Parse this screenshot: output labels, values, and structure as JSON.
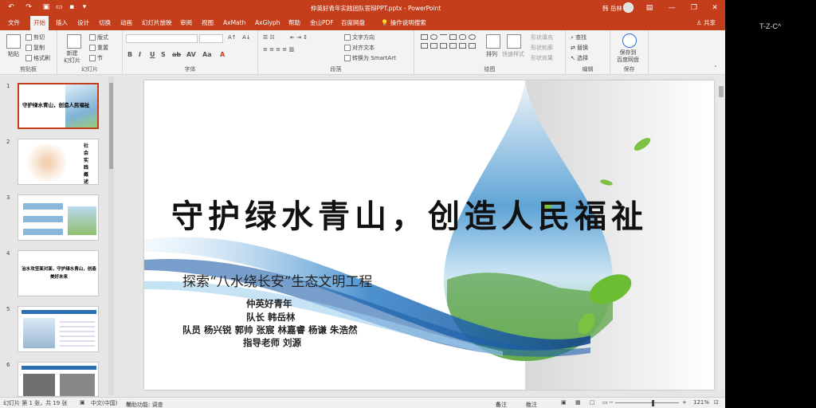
{
  "window": {
    "title": "仲英好青年实践团队答辩PPT.pptx  -  PowerPoint",
    "user": "韩 岳林"
  },
  "tabs": [
    "文件",
    "开始",
    "插入",
    "设计",
    "切换",
    "动画",
    "幻灯片放映",
    "审阅",
    "视图",
    "AxMath",
    "AxGlyph",
    "帮助",
    "金山PDF",
    "百度网盘",
    "操作说明搜索"
  ],
  "active_tab": "开始",
  "share_label": "共享",
  "ribbon": {
    "groups": {
      "clipboard": "剪贴板",
      "slides": "幻灯片",
      "font": "字体",
      "paragraph": "段落",
      "drawing": "绘图",
      "editing": "编辑",
      "save": "保存"
    },
    "clipboard": {
      "paste": "粘贴",
      "cut": "剪切",
      "copy": "复制",
      "format_painter": "格式刷"
    },
    "slides": {
      "new_slide": "新建\n幻灯片",
      "layout": "版式",
      "reset": "重置",
      "section": "节"
    },
    "paragraph": {
      "text_direction": "文字方向",
      "align_text": "对齐文本",
      "smartart": "转换为 SmartArt"
    },
    "drawing": {
      "arrange": "排列",
      "quick_styles": "快速样式",
      "shape_fill": "形状填充",
      "shape_outline": "形状轮廓",
      "shape_effects": "形状效果"
    },
    "editing": {
      "find": "查找",
      "replace": "替换",
      "select": "选择"
    },
    "save": {
      "save_to_baidu": "保存到\n百度网盘"
    }
  },
  "thumbnails": [
    {
      "num": "1",
      "text": "守护绿水青山，创造人民福祉"
    },
    {
      "num": "2",
      "text": "社会实践概述"
    },
    {
      "num": "3",
      "text": ""
    },
    {
      "num": "4",
      "text": "治水攻坚面对面，守护绿水青山，创造美好未来"
    },
    {
      "num": "5",
      "text": ""
    },
    {
      "num": "6",
      "text": ""
    }
  ],
  "slide": {
    "title": "守护绿水青山，创造人民福祉",
    "subtitle": "探索“八水绕长安”生态文明工程",
    "lines": [
      "仲英好青年",
      "队长 韩岳林",
      "队员 杨兴锐 郭帅 张宸 林嘉睿 杨谦 朱浩然",
      "指导老师 刘源"
    ]
  },
  "status": {
    "slide_info": "幻灯片 第 1 张，共 19 张",
    "language": "中文(中国)",
    "accessibility": "辅助功能: 调查",
    "notes": "备注",
    "comments": "批注",
    "zoom": "121%"
  },
  "side_label": "T-Z-C^",
  "colors": {
    "accent": "#c43e1c",
    "ribbon_bg": "#f3f3f3",
    "canvas_bg": "#e6e6e6"
  }
}
